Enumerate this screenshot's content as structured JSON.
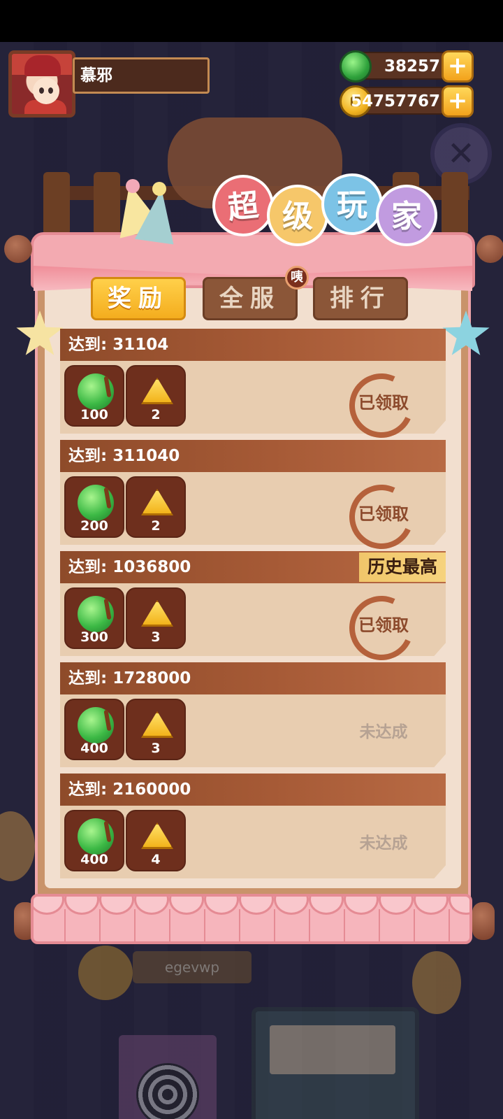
{
  "player": {
    "name": "慕邪"
  },
  "currencies": {
    "gems": "38257",
    "coins": "54757767"
  },
  "title": [
    "超",
    "级",
    "玩",
    "家"
  ],
  "title_colors": [
    "#ea6e75",
    "#f6c76a",
    "#7cc3e6",
    "#c19be0"
  ],
  "tabs": [
    {
      "label": "奖励",
      "active": true
    },
    {
      "label": "全服",
      "active": false
    },
    {
      "label": "排行",
      "active": false
    }
  ],
  "tab_badge": "咦",
  "rewards": [
    {
      "target": "达到: 31104",
      "apples": "100",
      "cheese": "2",
      "status": "已领取",
      "claimed": true,
      "record": ""
    },
    {
      "target": "达到: 311040",
      "apples": "200",
      "cheese": "2",
      "status": "已领取",
      "claimed": true,
      "record": ""
    },
    {
      "target": "达到: 1036800",
      "apples": "300",
      "cheese": "3",
      "status": "已领取",
      "claimed": true,
      "record": "历史最高"
    },
    {
      "target": "达到: 1728000",
      "apples": "400",
      "cheese": "3",
      "status": "未达成",
      "claimed": false,
      "record": ""
    },
    {
      "target": "达到: 2160000",
      "apples": "400",
      "cheese": "4",
      "status": "未达成",
      "claimed": false,
      "record": ""
    }
  ],
  "background": {
    "name_plate": "egevwp"
  },
  "icons": {
    "gem": "green-apple-gem-icon",
    "coin": "gold-coin-icon",
    "plus": "plus-icon",
    "apple": "green-apple-icon",
    "cheese": "cheese-icon"
  }
}
